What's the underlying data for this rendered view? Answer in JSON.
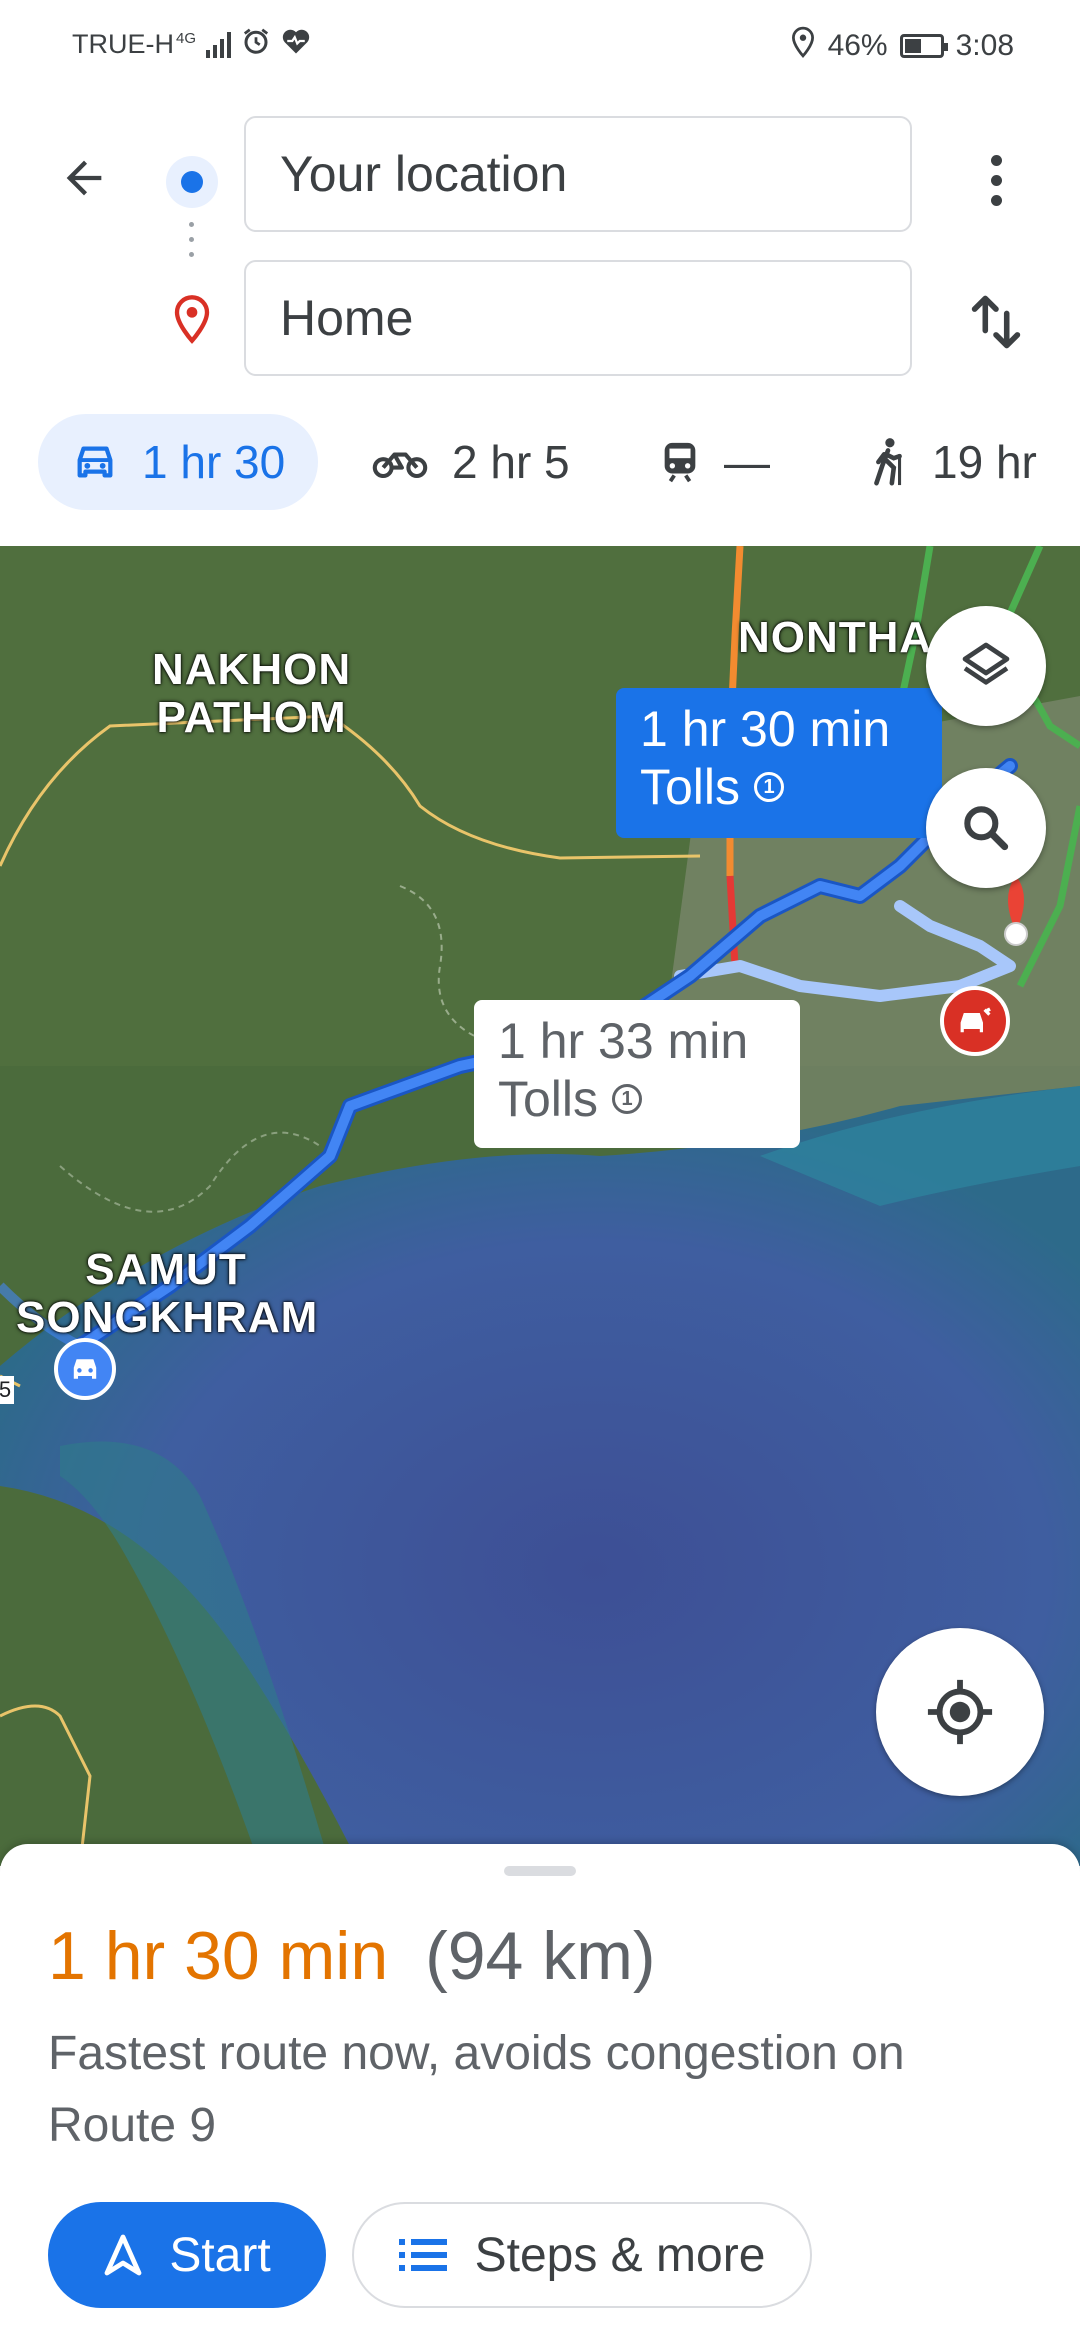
{
  "status_bar": {
    "carrier": "TRUE-H",
    "network": "4G",
    "battery": "46%",
    "battery_level": 0.46,
    "time": "3:08"
  },
  "directions": {
    "origin_value": "Your location",
    "destination_value": "Home",
    "modes": [
      {
        "name": "drive",
        "icon": "car-icon",
        "label": "1 hr 30",
        "selected": true
      },
      {
        "name": "motorcycle",
        "icon": "motorcycle-icon",
        "label": "2 hr 5",
        "selected": false
      },
      {
        "name": "transit",
        "icon": "train-icon",
        "label": "—",
        "selected": false
      },
      {
        "name": "walk",
        "icon": "walking-icon",
        "label": "19 hr",
        "selected": false
      }
    ]
  },
  "map": {
    "labels": {
      "nakhon_pathom": [
        "NAKHON",
        "PATHOM"
      ],
      "nonthaburi": "NONTHA",
      "samut_songkhram": [
        "SAMUT",
        "SONGKHRAM"
      ],
      "road_number": "5"
    },
    "primary_route": {
      "time": "1 hr 30 min",
      "note": "Tolls",
      "badge": "1"
    },
    "alternate_route": {
      "time": "1 hr 33 min",
      "note": "Tolls",
      "badge": "1"
    },
    "colors": {
      "route": "#4285f4",
      "alt_route": "#a8c7fa",
      "sea": "#3f5e9e",
      "land": "#4a6b3a"
    }
  },
  "sheet": {
    "duration": "1 hr 30 min",
    "distance": "(94 km)",
    "description": "Fastest route now, avoids congestion on Route 9",
    "start_label": "Start",
    "steps_label": "Steps & more"
  },
  "colors": {
    "accent": "#1a73e8",
    "duration": "#e37400"
  }
}
